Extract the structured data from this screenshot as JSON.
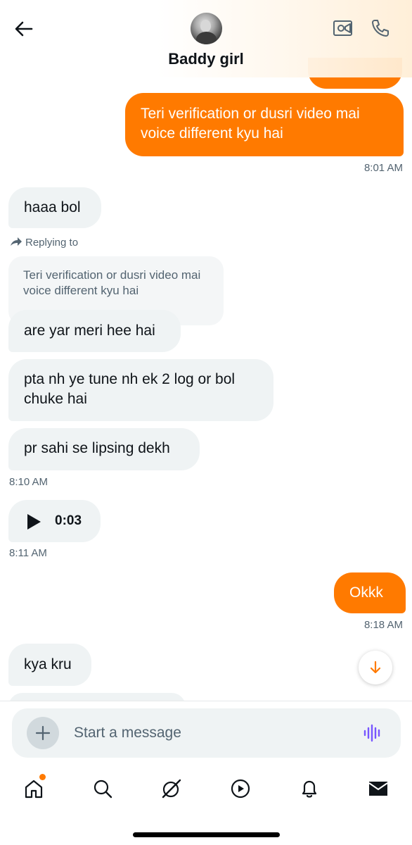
{
  "header": {
    "title": "Baddy girl"
  },
  "messages": {
    "out1_text": "Teri verification or dusri video mai voice different kyu hai",
    "out1_time": "8:01 AM",
    "in1_text": "haaa bol",
    "reply_label": "Replying to",
    "reply_quote": "Teri verification or dusri video mai voice different kyu hai",
    "in2_text": "are yar meri hee hai",
    "in3_text": "pta nh ye tune nh ek 2 log or bol chuke hai",
    "in4_text": "pr sahi se lipsing dekh",
    "in4_time": "8:10 AM",
    "voice_duration": "0:03",
    "voice_time": "8:11 AM",
    "out2_text": "Okkk",
    "out2_time": "8:18 AM",
    "in5_text": "kya kru"
  },
  "composer": {
    "placeholder": "Start a message"
  },
  "colors": {
    "accent": "#ff7a00",
    "incoming_bubble": "#eff3f4",
    "voice_icon": "#7856ff"
  },
  "icons": {
    "back": "arrow-left-icon",
    "video_call": "video-camera-icon",
    "voice_call": "phone-icon",
    "reply": "reply-arrow-icon",
    "play": "play-icon",
    "scroll_down": "arrow-down-icon",
    "add": "plus-icon",
    "voice_message": "audio-wave-icon",
    "nav": [
      "home-icon",
      "search-icon",
      "grok-icon",
      "video-play-icon",
      "bell-icon",
      "mail-icon"
    ]
  }
}
